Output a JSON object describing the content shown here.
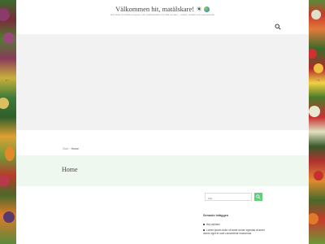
{
  "site": {
    "title": "Välkommen hit, matälskare! ☀",
    "tagline": "Här hittar du bästa recepten och matinspiration för alla smaker – enkelt, snabbt och inspirerande"
  },
  "colors": {
    "accent": "#5fcf7a",
    "header_band": "#eff8ee",
    "slider_bg": "#f2f2f2"
  },
  "icons": {
    "search": "magnifier-icon",
    "prev": "chevron-left-icon",
    "next": "chevron-right-icon",
    "title_decor": "globe-icon"
  },
  "slider": {
    "prev_label": "←",
    "next_label": "→"
  },
  "breadcrumb": {
    "home": "Start",
    "separator": "›",
    "current": "Home"
  },
  "page": {
    "title": "Home"
  },
  "sidebar": {
    "search": {
      "placeholder": "Sök ..."
    },
    "recent_posts": {
      "title": "Senaste inläggen",
      "items": [
        "Hej världen!",
        "Lorem ipsum dolor sit amet donec egestas at amet donec eget et sunt consectetur maecenas"
      ]
    }
  }
}
